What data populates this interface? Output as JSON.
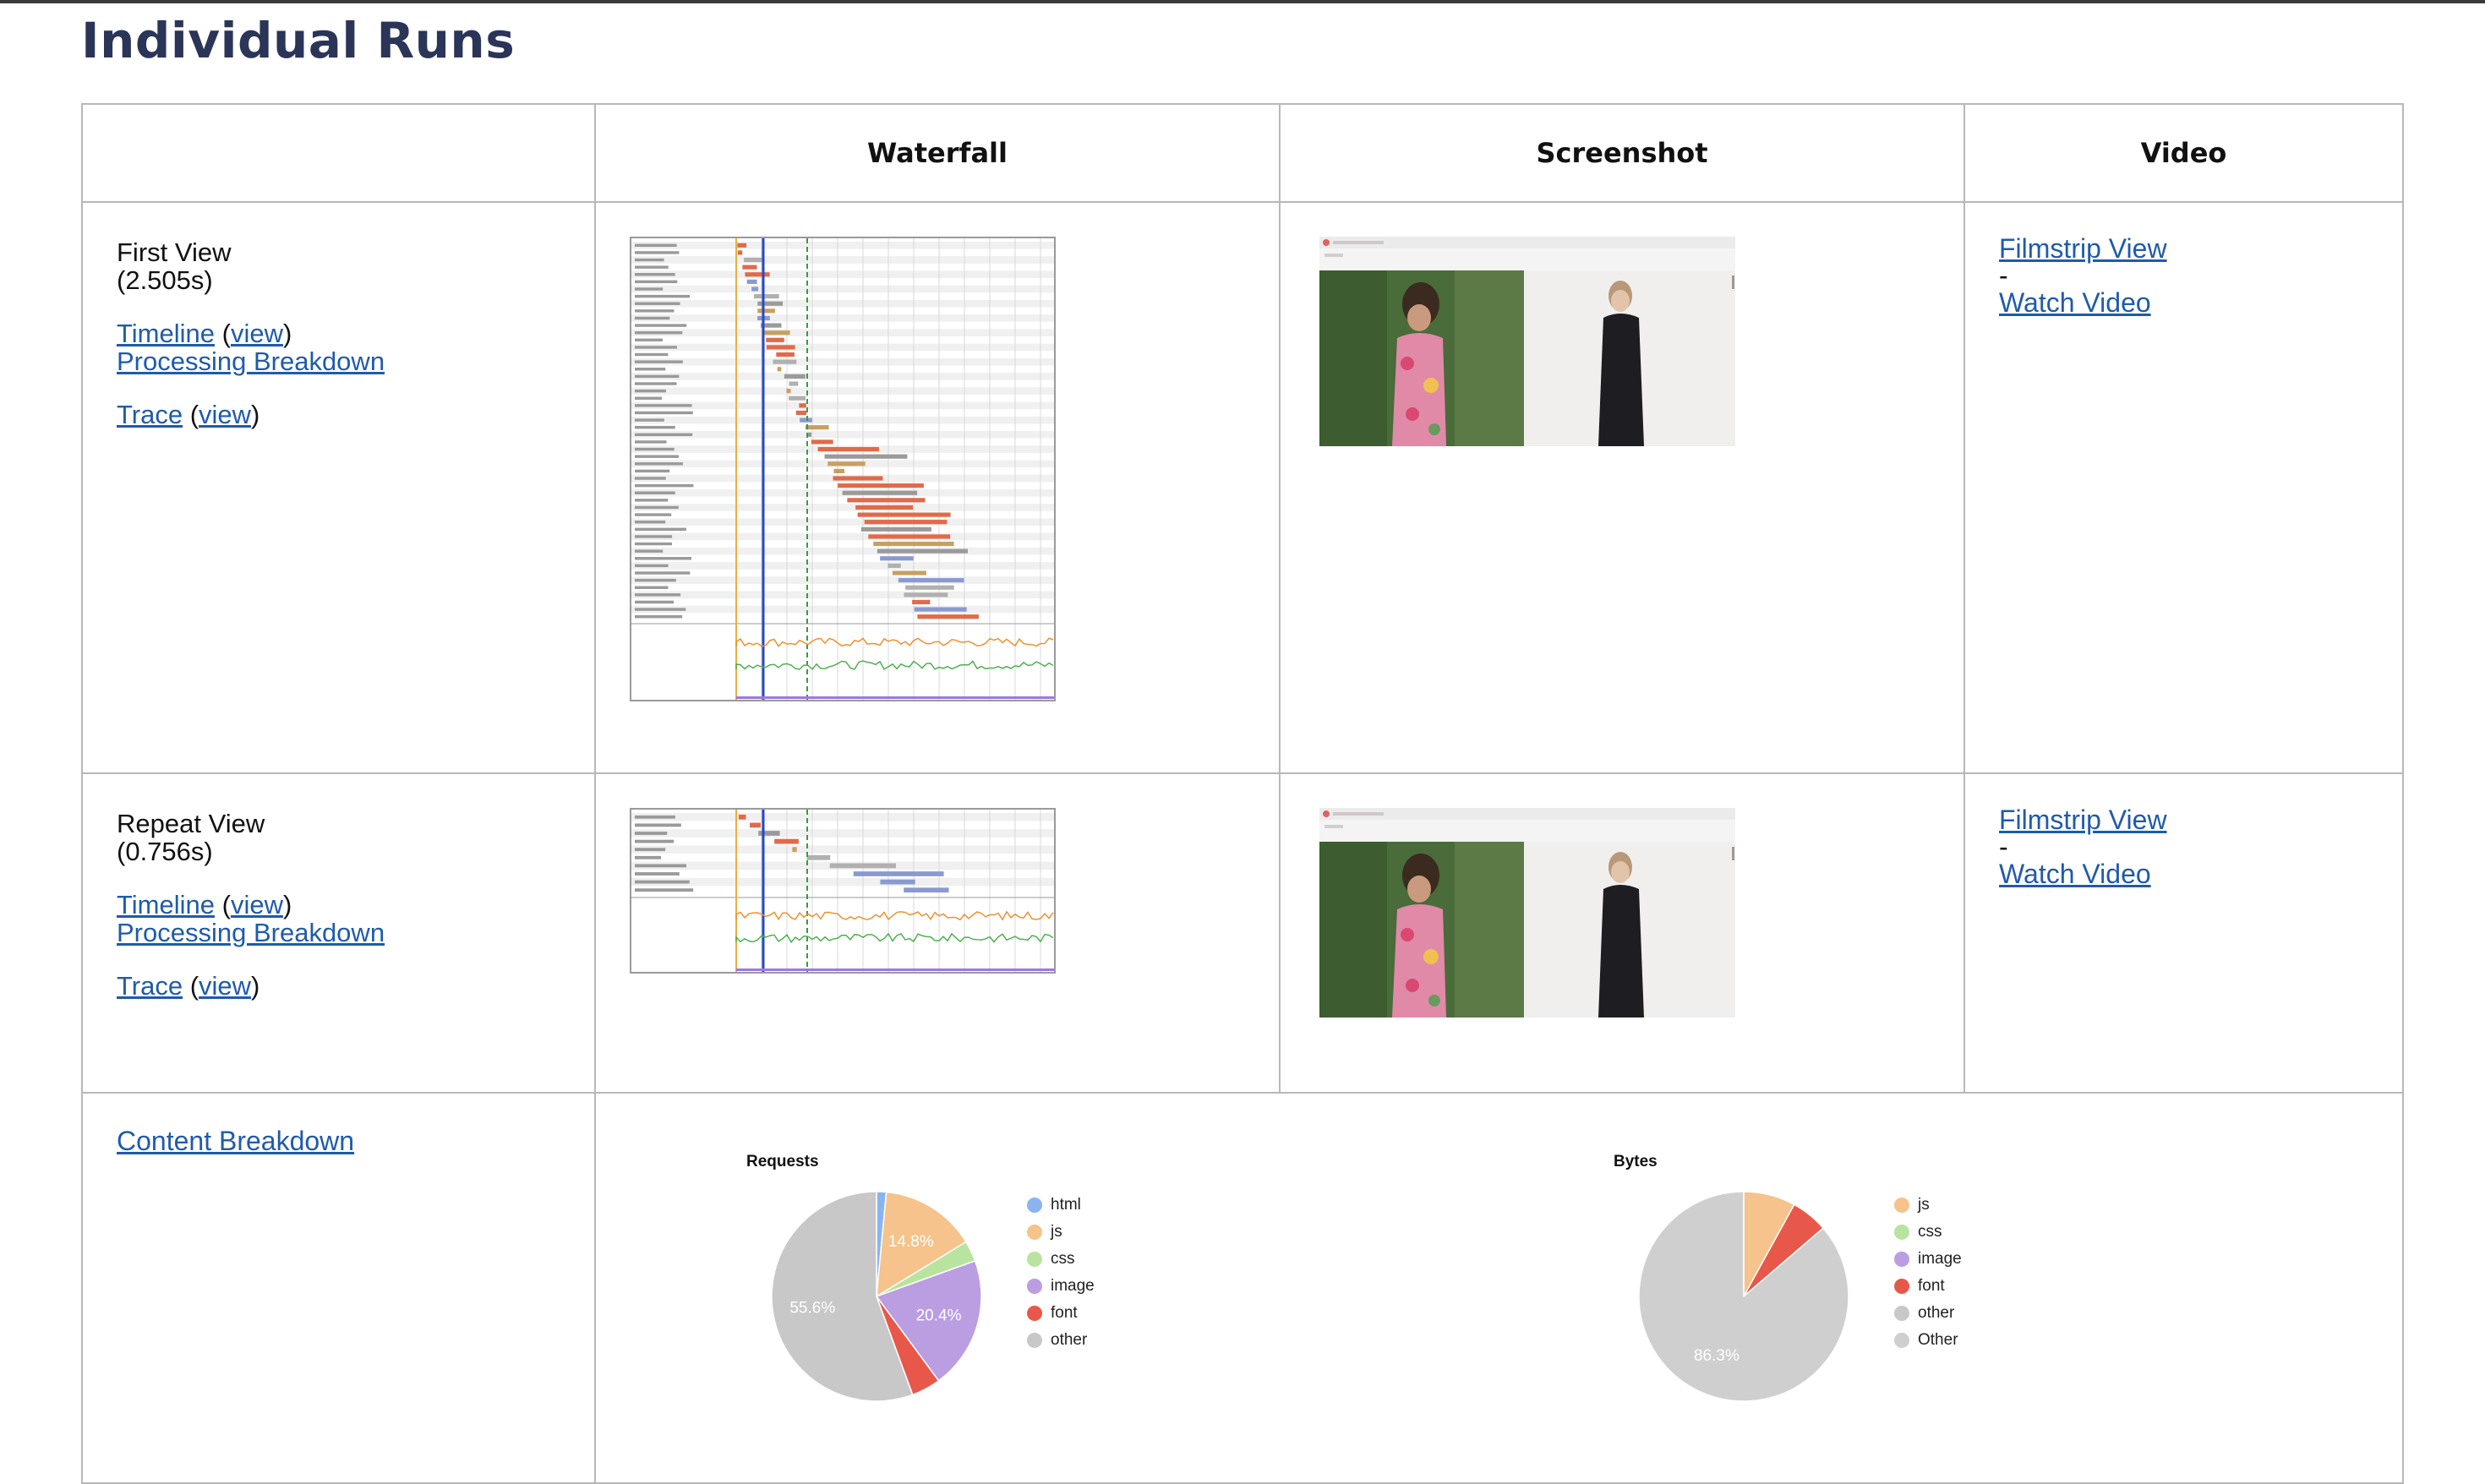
{
  "page": {
    "title": "Individual Runs"
  },
  "table": {
    "headers": {
      "waterfall": "Waterfall",
      "screenshot": "Screenshot",
      "video": "Video"
    }
  },
  "runs": [
    {
      "view_title": "First View",
      "view_time": "(2.505s)",
      "timeline_label": "Timeline",
      "view_label": "view",
      "processing_label": "Processing Breakdown",
      "trace_label": "Trace",
      "trace_view_label": "view",
      "filmstrip_label": "Filmstrip View",
      "dash": "-",
      "watch_label": "Watch Video"
    },
    {
      "view_title": "Repeat View",
      "view_time": "(0.756s)",
      "timeline_label": "Timeline",
      "view_label": "view",
      "processing_label": "Processing Breakdown",
      "trace_label": "Trace",
      "trace_view_label": "view",
      "filmstrip_label": "Filmstrip View",
      "dash": "-",
      "watch_label": "Watch Video"
    }
  ],
  "content": {
    "breakdown_label": "Content Breakdown"
  },
  "chart_data": [
    {
      "type": "pie",
      "title": "Requests",
      "categories": [
        "html",
        "js",
        "css",
        "image",
        "font",
        "other"
      ],
      "values": [
        1.5,
        14.8,
        3.2,
        20.4,
        4.5,
        55.6
      ],
      "slice_labels": [
        "",
        "14.8%",
        "",
        "20.4%",
        "",
        "55.6%"
      ],
      "colors": [
        "#8ab4f0",
        "#f5c38b",
        "#b9e4a0",
        "#bb9de2",
        "#e8584a",
        "#c8c8c8"
      ],
      "legend": "right"
    },
    {
      "type": "pie",
      "title": "Bytes",
      "categories": [
        "js",
        "css",
        "image",
        "font",
        "other",
        "Other"
      ],
      "values": [
        8.0,
        0.0,
        0.0,
        5.7,
        0.0,
        86.3
      ],
      "slice_labels": [
        "",
        "",
        "",
        "",
        "",
        "86.3%"
      ],
      "colors": [
        "#f5c38b",
        "#b9e4a0",
        "#bb9de2",
        "#e8584a",
        "#c8c8c8",
        "#cfcfcf"
      ],
      "legend": "right"
    }
  ]
}
